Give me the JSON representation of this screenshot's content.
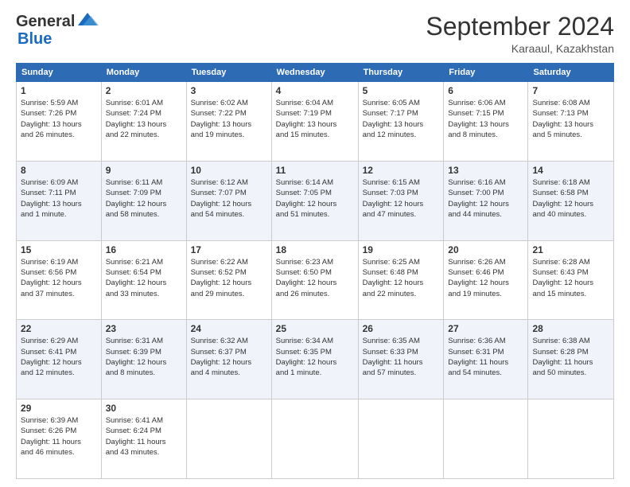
{
  "logo": {
    "general": "General",
    "blue": "Blue"
  },
  "header": {
    "month": "September 2024",
    "location": "Karaaul, Kazakhstan"
  },
  "weekdays": [
    "Sunday",
    "Monday",
    "Tuesday",
    "Wednesday",
    "Thursday",
    "Friday",
    "Saturday"
  ],
  "weeks": [
    [
      {
        "day": "1",
        "sunrise": "5:59 AM",
        "sunset": "7:26 PM",
        "daylight": "13 hours and 26 minutes."
      },
      {
        "day": "2",
        "sunrise": "6:01 AM",
        "sunset": "7:24 PM",
        "daylight": "13 hours and 22 minutes."
      },
      {
        "day": "3",
        "sunrise": "6:02 AM",
        "sunset": "7:22 PM",
        "daylight": "13 hours and 19 minutes."
      },
      {
        "day": "4",
        "sunrise": "6:04 AM",
        "sunset": "7:19 PM",
        "daylight": "13 hours and 15 minutes."
      },
      {
        "day": "5",
        "sunrise": "6:05 AM",
        "sunset": "7:17 PM",
        "daylight": "13 hours and 12 minutes."
      },
      {
        "day": "6",
        "sunrise": "6:06 AM",
        "sunset": "7:15 PM",
        "daylight": "13 hours and 8 minutes."
      },
      {
        "day": "7",
        "sunrise": "6:08 AM",
        "sunset": "7:13 PM",
        "daylight": "13 hours and 5 minutes."
      }
    ],
    [
      {
        "day": "8",
        "sunrise": "6:09 AM",
        "sunset": "7:11 PM",
        "daylight": "13 hours and 1 minute."
      },
      {
        "day": "9",
        "sunrise": "6:11 AM",
        "sunset": "7:09 PM",
        "daylight": "12 hours and 58 minutes."
      },
      {
        "day": "10",
        "sunrise": "6:12 AM",
        "sunset": "7:07 PM",
        "daylight": "12 hours and 54 minutes."
      },
      {
        "day": "11",
        "sunrise": "6:14 AM",
        "sunset": "7:05 PM",
        "daylight": "12 hours and 51 minutes."
      },
      {
        "day": "12",
        "sunrise": "6:15 AM",
        "sunset": "7:03 PM",
        "daylight": "12 hours and 47 minutes."
      },
      {
        "day": "13",
        "sunrise": "6:16 AM",
        "sunset": "7:00 PM",
        "daylight": "12 hours and 44 minutes."
      },
      {
        "day": "14",
        "sunrise": "6:18 AM",
        "sunset": "6:58 PM",
        "daylight": "12 hours and 40 minutes."
      }
    ],
    [
      {
        "day": "15",
        "sunrise": "6:19 AM",
        "sunset": "6:56 PM",
        "daylight": "12 hours and 37 minutes."
      },
      {
        "day": "16",
        "sunrise": "6:21 AM",
        "sunset": "6:54 PM",
        "daylight": "12 hours and 33 minutes."
      },
      {
        "day": "17",
        "sunrise": "6:22 AM",
        "sunset": "6:52 PM",
        "daylight": "12 hours and 29 minutes."
      },
      {
        "day": "18",
        "sunrise": "6:23 AM",
        "sunset": "6:50 PM",
        "daylight": "12 hours and 26 minutes."
      },
      {
        "day": "19",
        "sunrise": "6:25 AM",
        "sunset": "6:48 PM",
        "daylight": "12 hours and 22 minutes."
      },
      {
        "day": "20",
        "sunrise": "6:26 AM",
        "sunset": "6:46 PM",
        "daylight": "12 hours and 19 minutes."
      },
      {
        "day": "21",
        "sunrise": "6:28 AM",
        "sunset": "6:43 PM",
        "daylight": "12 hours and 15 minutes."
      }
    ],
    [
      {
        "day": "22",
        "sunrise": "6:29 AM",
        "sunset": "6:41 PM",
        "daylight": "12 hours and 12 minutes."
      },
      {
        "day": "23",
        "sunrise": "6:31 AM",
        "sunset": "6:39 PM",
        "daylight": "12 hours and 8 minutes."
      },
      {
        "day": "24",
        "sunrise": "6:32 AM",
        "sunset": "6:37 PM",
        "daylight": "12 hours and 4 minutes."
      },
      {
        "day": "25",
        "sunrise": "6:34 AM",
        "sunset": "6:35 PM",
        "daylight": "12 hours and 1 minute."
      },
      {
        "day": "26",
        "sunrise": "6:35 AM",
        "sunset": "6:33 PM",
        "daylight": "11 hours and 57 minutes."
      },
      {
        "day": "27",
        "sunrise": "6:36 AM",
        "sunset": "6:31 PM",
        "daylight": "11 hours and 54 minutes."
      },
      {
        "day": "28",
        "sunrise": "6:38 AM",
        "sunset": "6:28 PM",
        "daylight": "11 hours and 50 minutes."
      }
    ],
    [
      {
        "day": "29",
        "sunrise": "6:39 AM",
        "sunset": "6:26 PM",
        "daylight": "11 hours and 46 minutes."
      },
      {
        "day": "30",
        "sunrise": "6:41 AM",
        "sunset": "6:24 PM",
        "daylight": "11 hours and 43 minutes."
      },
      null,
      null,
      null,
      null,
      null
    ]
  ]
}
